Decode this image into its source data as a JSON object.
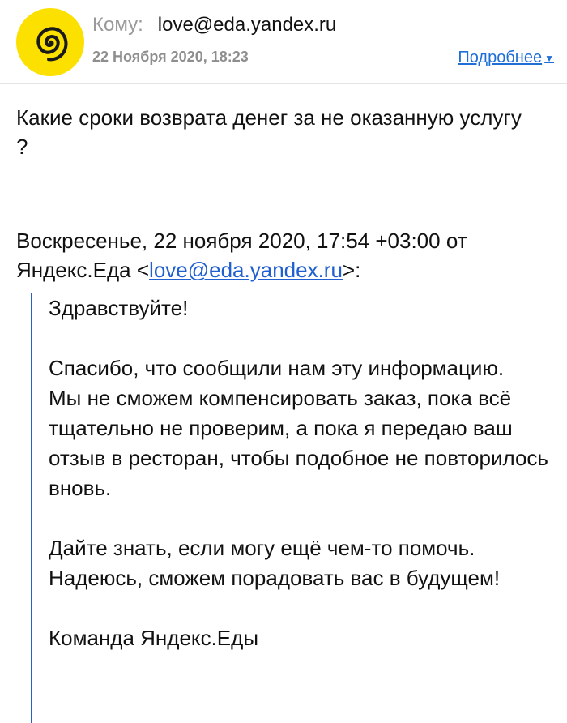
{
  "header": {
    "to_label": "Кому:",
    "to_address": "love@eda.yandex.ru",
    "date": "22 Ноября 2020, 18:23",
    "details_link": "Подробнее"
  },
  "avatar": {
    "icon": "spiral-icon",
    "bg_color": "#fce000"
  },
  "message": {
    "question": "Какие сроки возврата денег за не оказанную услугу ?",
    "reply_header_prefix": "Воскресенье, 22 ноября 2020, 17:54 +03:00 от Яндекс.Еда <",
    "reply_header_email": "love@eda.yandex.ru",
    "reply_header_suffix": ">:",
    "quote": {
      "greeting": "Здравствуйте!",
      "p1_line1": "Спасибо, что сообщили нам эту информацию.",
      "p1_line2": "Мы не сможем компенсировать заказ, пока всё тщательно не проверим, а пока я передаю ваш отзыв в ресторан, чтобы подобное не повторилось вновь.",
      "p2_line1": "Дайте знать, если могу ещё чем-то помочь.",
      "p2_line2": "Надеюсь, сможем порадовать вас в будущем!",
      "signature": "Команда Яндекс.Еды"
    }
  },
  "colors": {
    "link": "#1f6fd6",
    "quote_bar": "#2c5fbf",
    "muted": "#9a9a9a"
  }
}
